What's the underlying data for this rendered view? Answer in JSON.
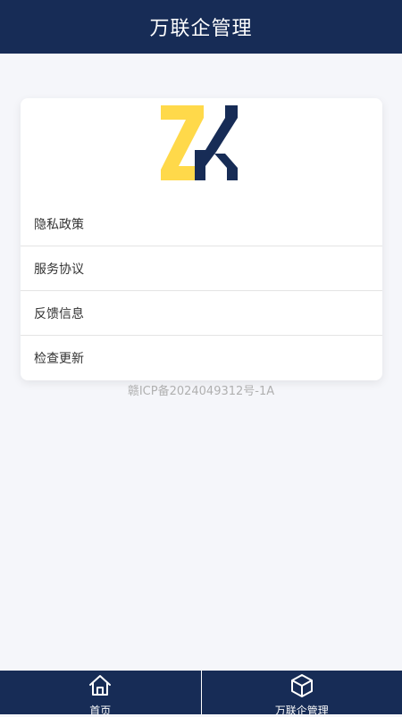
{
  "header": {
    "title": "万联企管理"
  },
  "logo": {
    "text": "ZK",
    "colors": {
      "z": "#ffd94a",
      "k": "#172c56"
    }
  },
  "menu": {
    "items": [
      {
        "label": "隐私政策"
      },
      {
        "label": "服务协议"
      },
      {
        "label": "反馈信息"
      },
      {
        "label": "检查更新"
      }
    ]
  },
  "footer": {
    "icp": "赣ICP备2024049312号-1A"
  },
  "tabbar": {
    "tabs": [
      {
        "label": "首页",
        "icon": "home-icon"
      },
      {
        "label": "万联企管理",
        "icon": "cube-icon"
      }
    ]
  },
  "colors": {
    "primary": "#172c56",
    "background": "#f5f6fa",
    "accent": "#ffd94a"
  }
}
